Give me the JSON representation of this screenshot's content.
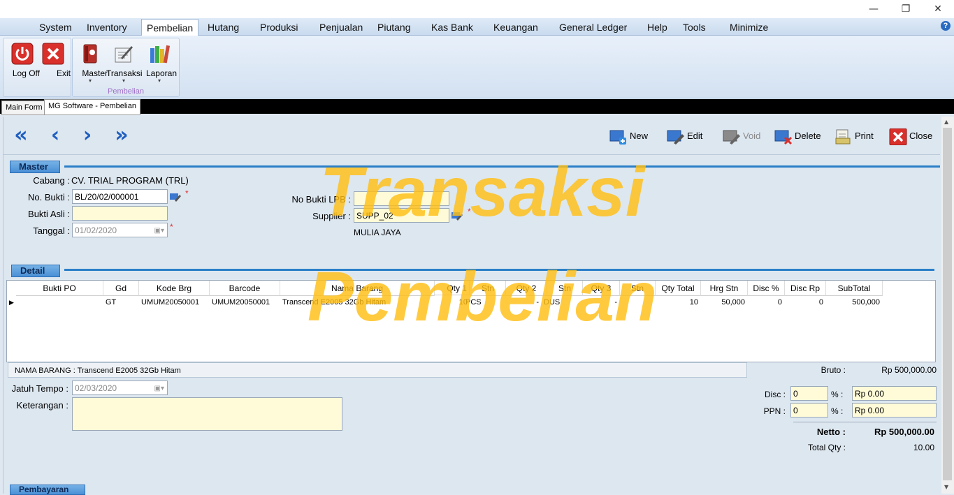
{
  "window": {
    "minimize_glyph": "—",
    "restore_glyph": "❐",
    "close_glyph": "✕"
  },
  "menu": {
    "items": [
      "System",
      "Inventory",
      "Pembelian",
      "Hutang",
      "Produksi",
      "Penjualan",
      "Piutang",
      "Kas Bank",
      "Keuangan",
      "General Ledger",
      "Help",
      "Tools",
      "Minimize"
    ],
    "active": "Pembelian",
    "help_glyph": "?"
  },
  "ribbon": {
    "logoff_label": "Log Off",
    "exit_label": "Exit",
    "master_label": "Master",
    "transaksi_label": "Transaksi",
    "laporan_label": "Laporan",
    "group_label": "Pembelian",
    "dropdown_glyph": "▾"
  },
  "tabs": [
    "Main Form",
    "MG Software - Pembelian"
  ],
  "toolbar": {
    "first_glyph": "«",
    "prev_glyph": "‹",
    "next_glyph": "›",
    "last_glyph": "»",
    "new_label": "New",
    "edit_label": "Edit",
    "void_label": "Void",
    "delete_label": "Delete",
    "print_label": "Print",
    "close_label": "Close"
  },
  "master": {
    "section_label": "Master",
    "cabang_label": "Cabang :",
    "cabang_value": "CV. TRIAL PROGRAM (TRL)",
    "no_bukti_label": "No. Bukti :",
    "no_bukti_value": "BL/20/02/000001",
    "bukti_asli_label": "Bukti Asli :",
    "bukti_asli_value": "",
    "tanggal_label": "Tanggal :",
    "tanggal_value": "01/02/2020",
    "no_bukti_lpb_label": "No Bukti LPB :",
    "no_bukti_lpb_value": "",
    "supplier_label": "Supplier :",
    "supplier_value": "SUPP_02",
    "supplier_name": "MULIA JAYA",
    "required_mark": "*"
  },
  "detail": {
    "section_label": "Detail",
    "columns": [
      "Bukti PO",
      "Gd",
      "Kode Brg",
      "Barcode",
      "Nama Barang",
      "Qty 1",
      "Stn",
      "Qty 2",
      "Stn",
      "Qty 3",
      "Stn",
      "Qty Total",
      "Hrg Stn",
      "Disc %",
      "Disc Rp",
      "SubTotal"
    ],
    "rows": [
      [
        "",
        "GT",
        "UMUM20050001",
        "UMUM20050001",
        "Transcend E2005 32Gb Hitam",
        "10",
        "PCS",
        "-",
        "DUS",
        "-",
        "",
        "10",
        "50,000",
        "0",
        "0",
        "500,000"
      ]
    ],
    "row_marker": "▶"
  },
  "status_text": "NAMA BARANG : Transcend E2005 32Gb Hitam",
  "footer": {
    "jatuh_tempo_label": "Jatuh Tempo :",
    "jatuh_tempo_value": "02/03/2020",
    "keterangan_label": "Keterangan :",
    "keterangan_value": "",
    "pembayaran_label": "Pembayaran"
  },
  "totals": {
    "bruto_label": "Bruto :",
    "bruto_value": "Rp 500,000.00",
    "disc_label": "Disc :",
    "disc_pct": "0",
    "disc_rp": "Rp 0.00",
    "ppn_label": "PPN :",
    "ppn_pct": "0",
    "ppn_rp": "Rp 0.00",
    "pct_sign": "%  :",
    "netto_label": "Netto :",
    "netto_value": "Rp 500,000.00",
    "total_qty_label": "Total Qty :",
    "total_qty_value": "10.00"
  },
  "watermark": {
    "line1": "Transaksi",
    "line2": "Pembelian"
  },
  "colors": {
    "accent": "#2a7fc8",
    "watermark": "#ffbe14",
    "field_yellow": "#fffbd8"
  }
}
